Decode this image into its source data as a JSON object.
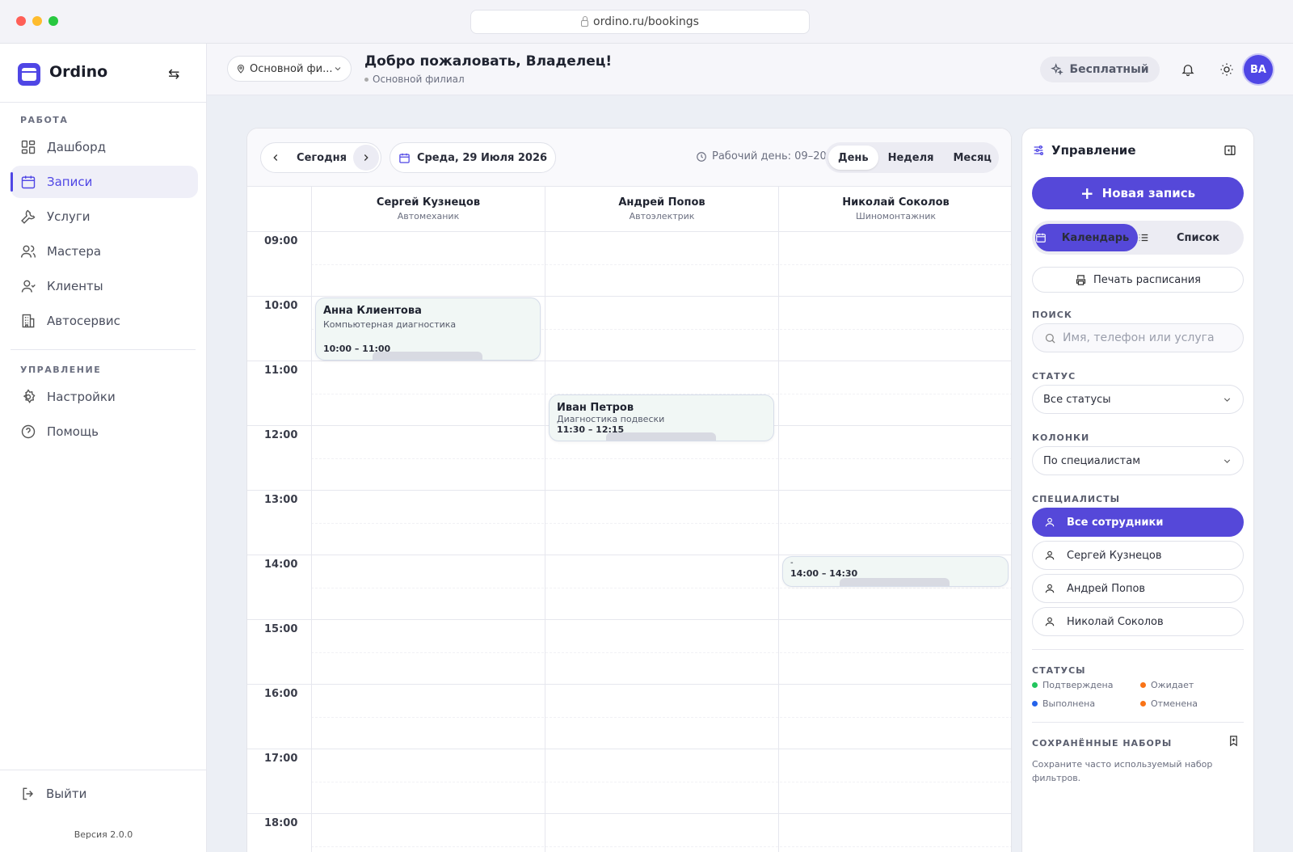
{
  "browser": {
    "url": "ordino.ru/bookings"
  },
  "sidebar": {
    "brand": "Ordino",
    "sections": {
      "work": "РАБОТА",
      "manage": "УПРАВЛЕНИЕ"
    },
    "items": [
      {
        "label": "Дашборд",
        "icon": "dashboard-icon"
      },
      {
        "label": "Записи",
        "icon": "calendar-icon",
        "active": true
      },
      {
        "label": "Услуги",
        "icon": "wrench-icon"
      },
      {
        "label": "Мастера",
        "icon": "users-icon"
      },
      {
        "label": "Клиенты",
        "icon": "clients-icon"
      },
      {
        "label": "Автосервис",
        "icon": "building-icon"
      },
      {
        "label": "Настройки",
        "icon": "gear-icon"
      },
      {
        "label": "Помощь",
        "icon": "help-icon"
      }
    ],
    "logout": "Выйти",
    "version": "Версия 2.0.0"
  },
  "topbar": {
    "branch_select": "Основной фи...",
    "welcome": "Добро пожаловать, Владелец!",
    "branch_sub": "Основной филиал",
    "plan": "Бесплатный",
    "avatar": "ВА"
  },
  "calendar": {
    "today": "Сегодня",
    "date": "Среда, 29 Июля 2026",
    "workday": "Рабочий день: 09–20",
    "views": [
      "День",
      "Неделя",
      "Месяц"
    ],
    "active_view": "День",
    "columns": [
      {
        "name": "Сергей Кузнецов",
        "role": "Автомеханик"
      },
      {
        "name": "Андрей Попов",
        "role": "Автоэлектрик"
      },
      {
        "name": "Николай Соколов",
        "role": "Шиномонтажник"
      }
    ],
    "hours": [
      "09:00",
      "10:00",
      "11:00",
      "12:00",
      "13:00",
      "14:00",
      "15:00",
      "16:00",
      "17:00",
      "18:00"
    ],
    "appointments": [
      {
        "column": 0,
        "client": "Анна Клиентова",
        "service": "Компьютерная диагностика",
        "time": "10:00 – 11:00",
        "start": "10:00",
        "end": "11:00"
      },
      {
        "column": 1,
        "client": "Иван Петров",
        "service": "Диагностика подвески",
        "time": "11:30 – 12:15",
        "start": "11:30",
        "end": "12:15"
      },
      {
        "column": 2,
        "client": "-",
        "service": "",
        "time": "14:00 – 14:30",
        "start": "14:00",
        "end": "14:30"
      }
    ]
  },
  "panel": {
    "title": "Управление",
    "new_booking": "Новая запись",
    "view_switch": [
      "Календарь",
      "Список"
    ],
    "print": "Печать расписания",
    "search_label": "ПОИСК",
    "search_placeholder": "Имя, телефон или услуга",
    "status_label": "СТАТУС",
    "status_value": "Все статусы",
    "columns_label": "КОЛОНКИ",
    "columns_value": "По специалистам",
    "specialists_label": "СПЕЦИАЛИСТЫ",
    "specialists": [
      "Все сотрудники",
      "Сергей Кузнецов",
      "Андрей Попов",
      "Николай Соколов"
    ],
    "statuses_label": "СТАТУСЫ",
    "statuses": [
      {
        "label": "Подтверждена",
        "color": "#22c55e"
      },
      {
        "label": "Ожидает",
        "color": "#f97316"
      },
      {
        "label": "Выполнена",
        "color": "#2563eb"
      },
      {
        "label": "Отменена",
        "color": "#f97316"
      }
    ],
    "saved_label": "СОХРАНЁННЫЕ НАБОРЫ",
    "saved_note": "Сохраните часто используемый набор фильтров."
  },
  "colors": {
    "accent": "#5548d9",
    "appointment_bg": "#f1f7f5"
  }
}
